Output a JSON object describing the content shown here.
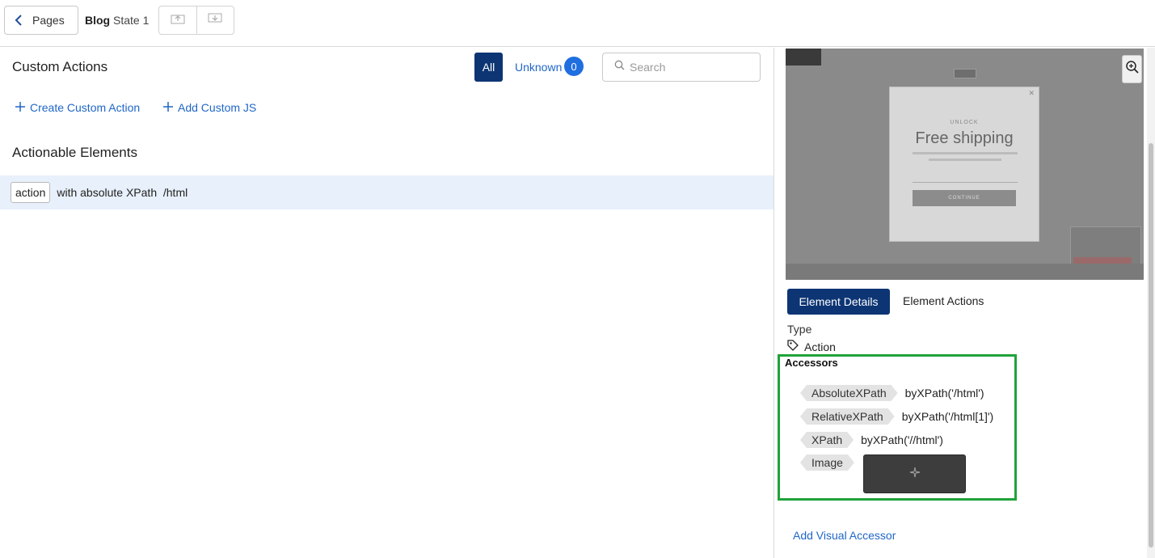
{
  "topbar": {
    "pages_label": "Pages",
    "breadcrumb_page": "Blog",
    "breadcrumb_state": "State 1"
  },
  "left": {
    "custom_actions_title": "Custom Actions",
    "filter_all": "All",
    "filter_unknown": "Unknown",
    "unknown_count": "0",
    "search_placeholder": "Search",
    "create_custom_action": "Create Custom Action",
    "add_custom_js": "Add Custom JS",
    "actionable_title": "Actionable Elements",
    "elements": [
      {
        "chip": "action",
        "text": "with absolute XPath  /html"
      }
    ]
  },
  "preview": {
    "unlock": "UNLOCK",
    "headline": "Free shipping",
    "button": "CONTINUE"
  },
  "details": {
    "tab_details": "Element Details",
    "tab_actions": "Element Actions",
    "type_label": "Type",
    "type_value": "Action",
    "accessors_title": "Accessors",
    "accessors": [
      {
        "name": "AbsoluteXPath",
        "value": "byXPath('/html')"
      },
      {
        "name": "RelativeXPath",
        "value": "byXPath('/html[1]')"
      },
      {
        "name": "XPath",
        "value": "byXPath('//html')"
      },
      {
        "name": "Image",
        "value": ""
      }
    ],
    "add_visual_accessor": "Add Visual Accessor"
  },
  "colors": {
    "primary": "#0d3574",
    "link": "#1f66c6",
    "badge": "#1f6fe0",
    "highlight_row": "#e8f0fb",
    "accessor_outline": "#1fa33a"
  }
}
